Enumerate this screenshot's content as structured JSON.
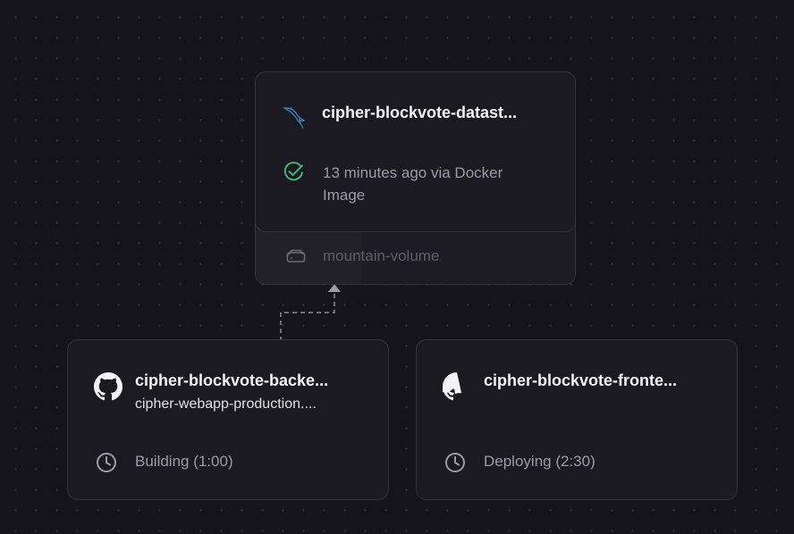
{
  "database_service": {
    "name": "cipher-blockvote-datast...",
    "icon": "mysql-dolphin-icon",
    "status": "13 minutes ago via Docker Image",
    "status_icon": "check-circle-icon",
    "status_color": "#4caf6e",
    "volume": {
      "icon": "hard-drive-icon",
      "label": "mountain-volume"
    }
  },
  "services": [
    {
      "name": "cipher-blockvote-backe...",
      "domain": "cipher-webapp-production....",
      "icon": "github-icon",
      "status": "Building (1:00)",
      "status_icon": "clock-icon"
    },
    {
      "name": "cipher-blockvote-fronte...",
      "domain": "",
      "icon": "github-icon",
      "status": "Deploying (2:30)",
      "status_icon": "clock-icon"
    }
  ],
  "colors": {
    "canvas_background": "#15141c",
    "card_background": "#1b1a23",
    "card_border": "#34323d",
    "connector": "#9d9aa8"
  }
}
